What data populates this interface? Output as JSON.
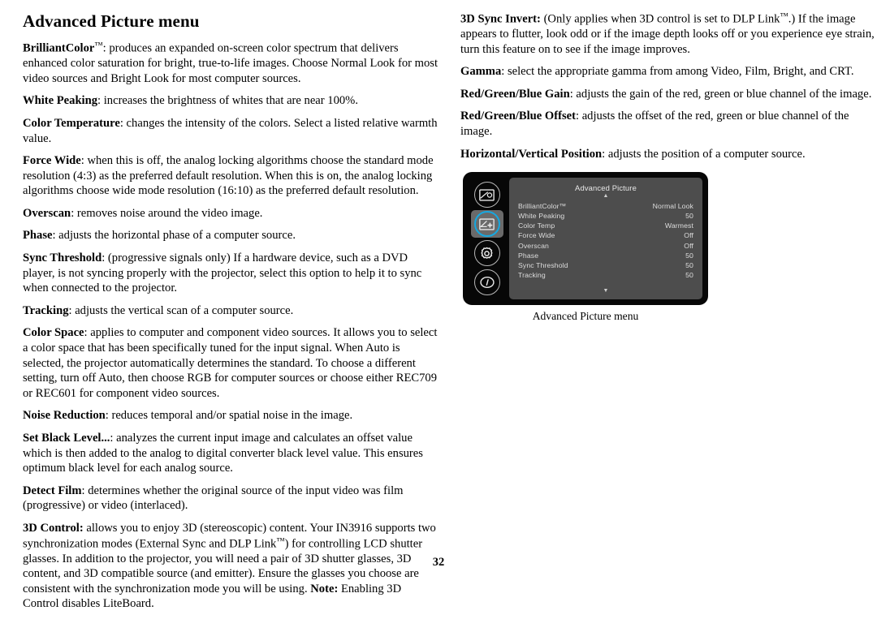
{
  "page": {
    "title": "Advanced Picture menu",
    "number": "32"
  },
  "left_column": {
    "entries": [
      {
        "term": "BrilliantColor",
        "tm": true,
        "body": ": produces an expanded on-screen color spectrum that delivers enhanced color saturation for bright, true-to-life images. Choose Normal Look for most video sources and Bright Look for most computer sources."
      },
      {
        "term": "White Peaking",
        "tm": false,
        "body": ": increases the brightness of whites that are near 100%."
      },
      {
        "term": "Color Temperature",
        "tm": false,
        "body": ": changes the intensity of the colors. Select a listed relative warmth value."
      },
      {
        "term": "Force Wide",
        "tm": false,
        "body": ": when this is off, the analog locking algorithms choose the standard mode resolution (4:3) as the preferred default resolution. When this is on, the analog locking algorithms choose wide mode resolution (16:10) as the preferred default resolution."
      },
      {
        "term": "Overscan",
        "tm": false,
        "body": ": removes noise around the video image."
      },
      {
        "term": "Phase",
        "tm": false,
        "body": ": adjusts the horizontal phase of a computer source."
      },
      {
        "term": "Sync Threshold",
        "tm": false,
        "body": ": (progressive signals only) If a hardware device, such as a DVD player, is not syncing properly with the projector, select this option to help it to sync when connected to the projector."
      },
      {
        "term": "Tracking",
        "tm": false,
        "body": ": adjusts the vertical scan of a computer source."
      },
      {
        "term": "Color Space",
        "tm": false,
        "body": ": applies to computer and component video sources. It allows you to select a color space that has been specifically tuned for the input signal. When Auto is selected, the projector automatically determines the standard. To choose a different setting, turn off Auto, then choose RGB for computer sources or choose either REC709 or REC601 for component video sources."
      },
      {
        "term": "Noise Reduction",
        "tm": false,
        "body": ": reduces temporal and/or spatial noise in the image."
      },
      {
        "term": "Set Black Level...",
        "tm": false,
        "body": ": analyzes the current input image and calculates an offset value which is then added to the analog to digital converter black level value. This ensures optimum black level for each analog source."
      },
      {
        "term": "Detect Film",
        "tm": false,
        "body": ": determines whether the original source of the input video was film (progressive) or video (interlaced)."
      }
    ],
    "control_3d": {
      "term": "3D Control:",
      "body_part1": " allows you to enjoy 3D (stereoscopic) content. Your IN3916 supports two synchronization modes (External Sync and DLP Link",
      "body_part2": ") for controlling LCD shutter glasses. In addition to the projector, you will need a pair of 3D shutter glasses, 3D content, and 3D compatible source (and emitter).  Ensure the glasses you choose are consistent with the synchronization mode you will be using. ",
      "note_label": "Note:",
      "body_part3": " Enabling 3D Control disables LiteBoard."
    }
  },
  "right_column": {
    "sync_invert": {
      "term": "3D Sync Invert:",
      "body_part1": " (Only applies when 3D control is set to DLP Link",
      "body_part2": ".) If the image appears to flutter, look odd or if the image depth looks off or you experience eye strain, turn this feature on to see if the image improves."
    },
    "entries": [
      {
        "term": "Gamma",
        "body": ": select the appropriate gamma from among Video, Film, Bright, and CRT."
      },
      {
        "term": "Red/Green/Blue Gain",
        "body": ": adjusts the gain of the red, green or blue channel of the image."
      },
      {
        "term": "Red/Green/Blue Offset",
        "body": ": adjusts the offset of the red, green or blue channel of the image."
      },
      {
        "term": "Horizontal/Vertical Position",
        "body": ": adjusts the position of a computer source."
      }
    ]
  },
  "osd": {
    "title": "Advanced Picture",
    "scroll_up": "▲",
    "scroll_down": "▼",
    "caption": "Advanced Picture menu",
    "accent_color": "#16a8e0",
    "panel_color": "#4d4d4d",
    "frame_color": "#070707",
    "rail": [
      {
        "name": "basic-picture-icon",
        "selected": false
      },
      {
        "name": "advanced-picture-icon",
        "selected": true
      },
      {
        "name": "settings-gear-icon",
        "selected": false
      },
      {
        "name": "info-icon",
        "selected": false
      }
    ],
    "rows": [
      {
        "label": "BrilliantColor™",
        "value": "Normal Look"
      },
      {
        "label": "White Peaking",
        "value": "50"
      },
      {
        "label": "Color Temp",
        "value": "Warmest"
      },
      {
        "label": "Force Wide",
        "value": "Off"
      },
      {
        "label": "Overscan",
        "value": "Off"
      },
      {
        "label": "Phase",
        "value": "50"
      },
      {
        "label": "Sync Threshold",
        "value": "50"
      },
      {
        "label": "Tracking",
        "value": "50"
      }
    ]
  }
}
